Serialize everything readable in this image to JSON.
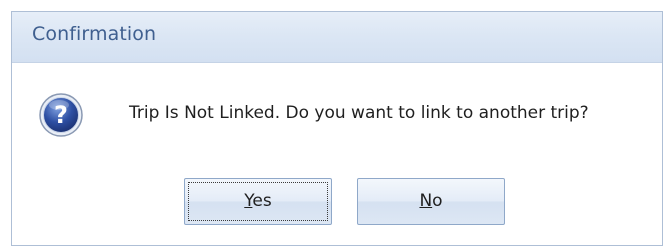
{
  "dialog": {
    "title": "Confirmation",
    "icon": "question-icon",
    "message": "Trip Is Not Linked. Do you want to link to another trip?"
  },
  "buttons": {
    "yes": {
      "accel": "Y",
      "rest": "es"
    },
    "no": {
      "accel": "N",
      "rest": "o"
    }
  },
  "colors": {
    "title_text": "#3f5f8f",
    "titlebar_bg": "#dbe6f4",
    "icon_blue": "#2d4fa3",
    "button_border": "#8fa8c9"
  }
}
